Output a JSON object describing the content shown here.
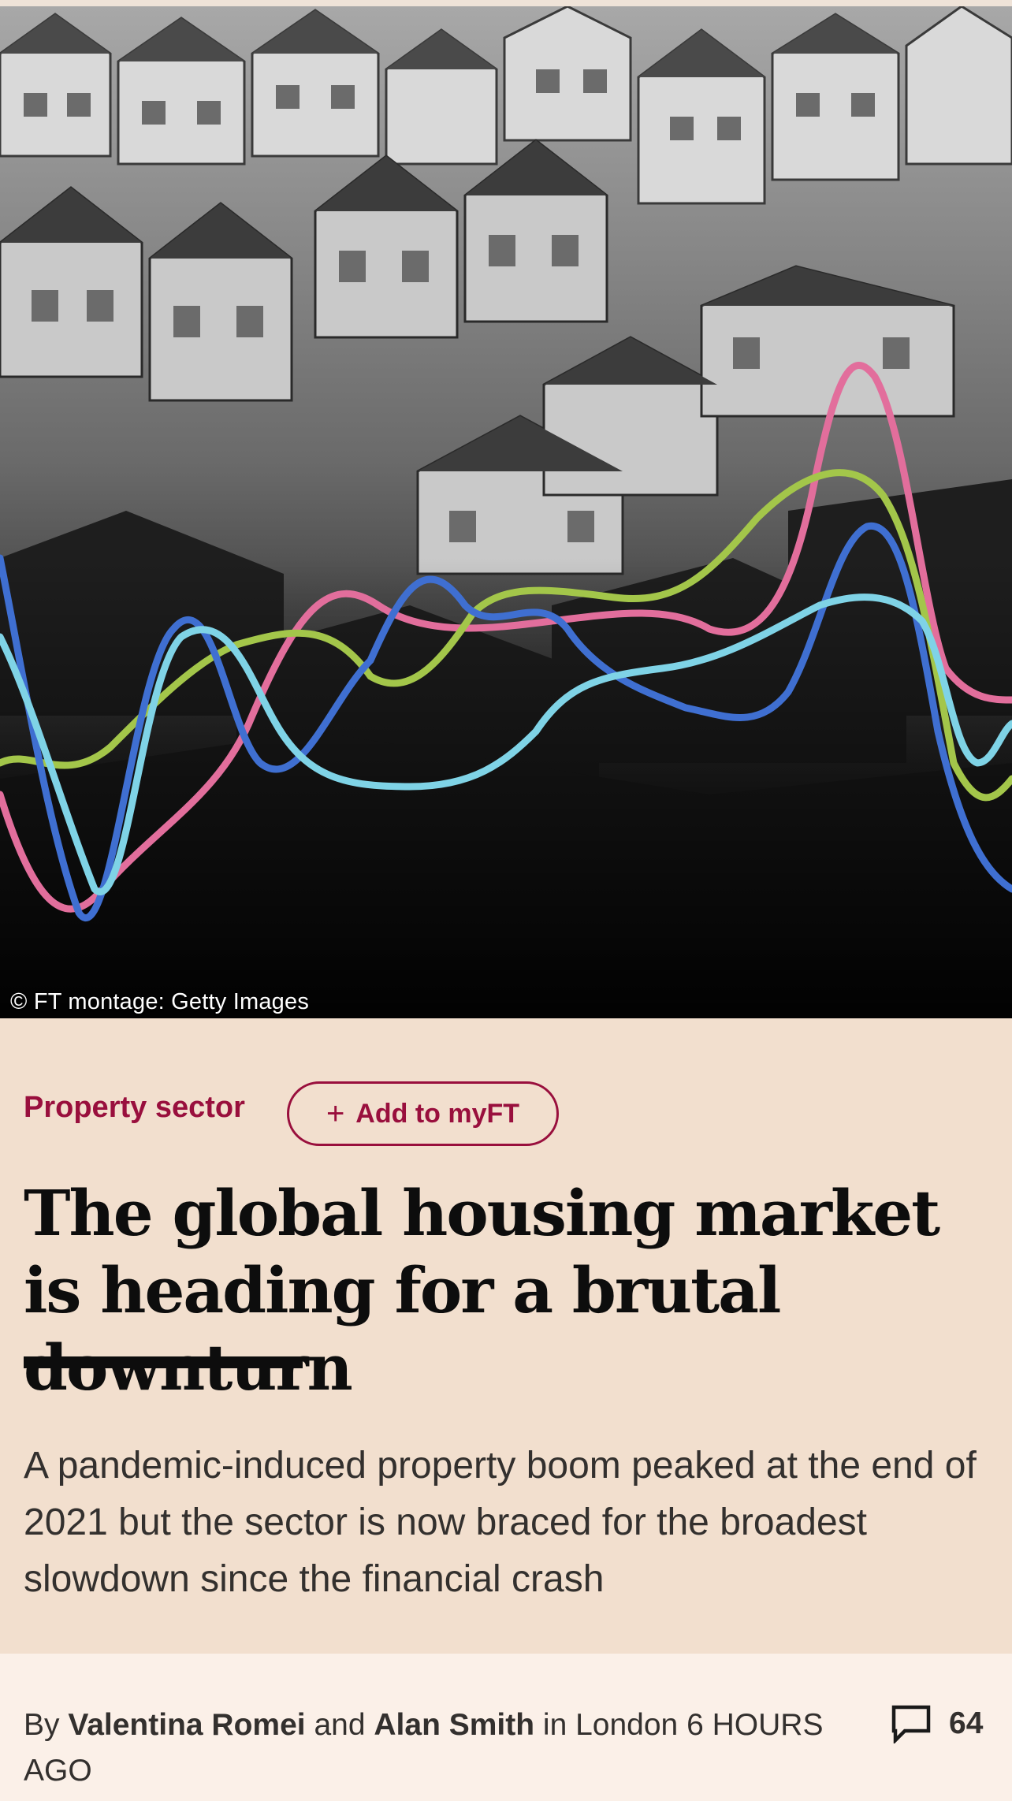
{
  "hero": {
    "caption": "© FT montage: Getty Images",
    "line_colors": {
      "pink": "#e26e9c",
      "green": "#a3c64a",
      "blue": "#3f6fd1",
      "cyan": "#7fd3e6"
    }
  },
  "article": {
    "topic": "Property sector",
    "myft_label": "Add to myFT",
    "headline": "The global housing market is heading for a brutal downturn",
    "standfirst": "A pandemic-induced property boom peaked at the end of 2021 but the sector is now braced for the broadest slowdown since the financial crash"
  },
  "byline": {
    "prefix": "By",
    "author1": "Valentina Romei",
    "conjunction": "and",
    "author2": "Alan Smith",
    "location": "in London",
    "time": "6 HOURS AGO",
    "comments_count": "64"
  },
  "colors": {
    "background": "#f2dfce",
    "accent": "#990f3d",
    "byline_band": "#fbf0e8"
  }
}
